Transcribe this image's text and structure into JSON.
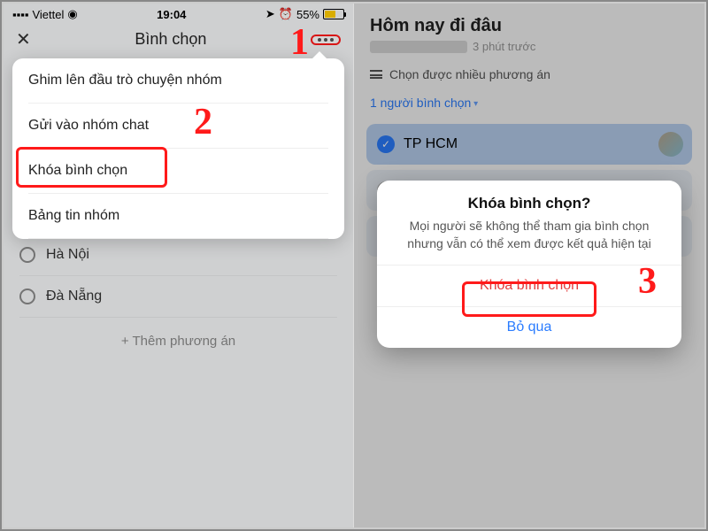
{
  "annotations": {
    "step1": "1",
    "step2": "2",
    "step3": "3"
  },
  "left": {
    "status": {
      "carrier": "Viettel",
      "wifi": "▲",
      "time": "19:04",
      "alarm": "⏰",
      "battery_pct": "55%"
    },
    "header_title": "Bình chọn",
    "popover": {
      "pin": "Ghim lên đầu trò chuyện nhóm",
      "send": "Gửi vào nhóm chat",
      "lock": "Khóa bình chọn",
      "board": "Bảng tin nhóm"
    },
    "options": {
      "hn": "Hà Nội",
      "dn": "Đà Nẵng"
    },
    "add_option": "+   Thêm phương án"
  },
  "right": {
    "title": "Hôm nay đi đâu",
    "time_ago": "3 phút trước",
    "multi_label": "Chọn được nhiều phương án",
    "voters": "1 người bình chọn",
    "option1": "TP HCM",
    "dialog": {
      "title": "Khóa bình chọn?",
      "body": "Mọi người sẽ không thể tham gia bình chọn nhưng vẫn có thể xem được kết quả hiện tại",
      "confirm": "Khóa bình chọn",
      "cancel": "Bỏ qua"
    }
  }
}
